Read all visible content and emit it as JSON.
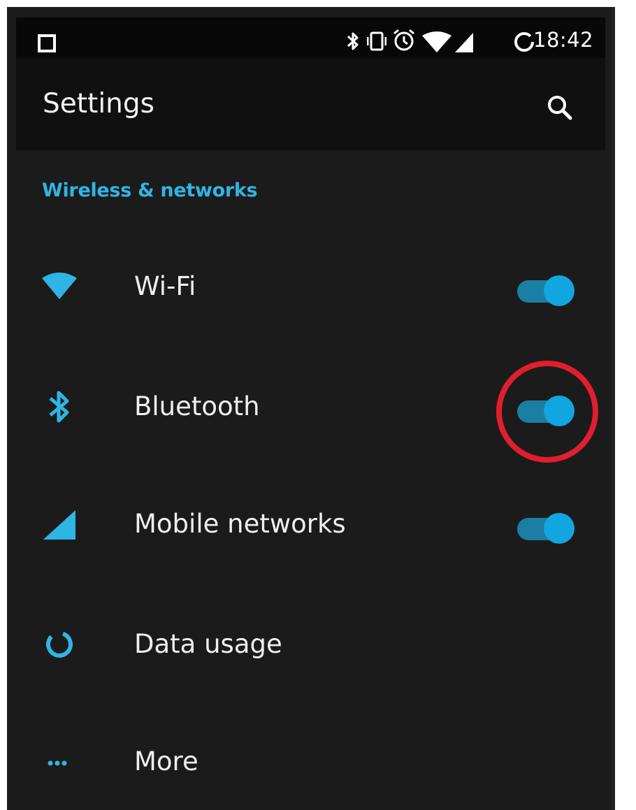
{
  "status_bar": {
    "time": "18:42",
    "icons": [
      "notification-square-icon",
      "bluetooth-icon",
      "vibrate-icon",
      "alarm-icon",
      "wifi-icon",
      "cell-signal-icon",
      "data-saver-icon"
    ]
  },
  "app_bar": {
    "title": "Settings",
    "search_icon": "search-icon"
  },
  "section": {
    "header": "Wireless & networks",
    "items": [
      {
        "label": "Wi-Fi",
        "icon": "wifi-icon",
        "toggle": true
      },
      {
        "label": "Bluetooth",
        "icon": "bluetooth-icon",
        "toggle": true
      },
      {
        "label": "Mobile networks",
        "icon": "cell-signal-icon",
        "toggle": true
      },
      {
        "label": "Data usage",
        "icon": "data-usage-icon"
      },
      {
        "label": "More",
        "icon": "more-dots-icon"
      }
    ]
  },
  "colors": {
    "accent": "#2fb5e4",
    "toggle_track": "#1b7ea3",
    "toggle_knob": "#11a6df",
    "background": "#1b1b1b",
    "highlight": "#e01e2f"
  }
}
